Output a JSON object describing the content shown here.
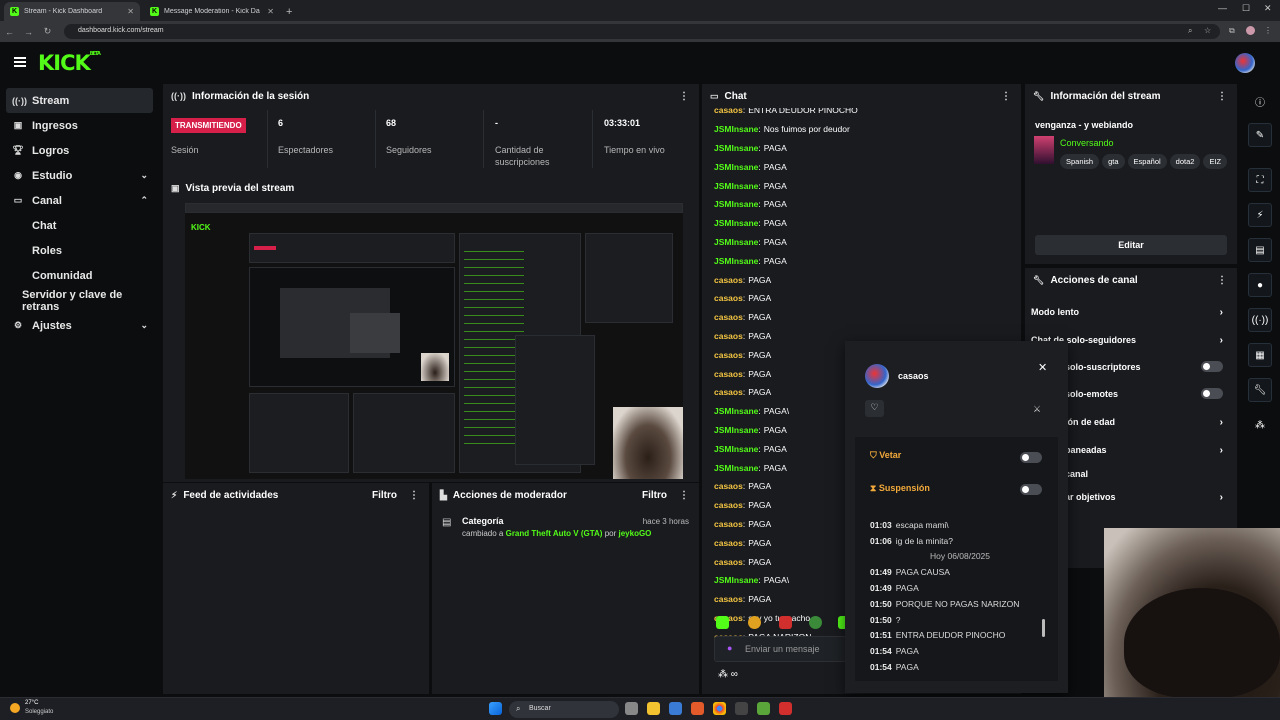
{
  "browser": {
    "tabs": [
      {
        "title": "Stream - Kick Dashboard",
        "active": true
      },
      {
        "title": "Message Moderation - Kick Da",
        "active": false
      }
    ],
    "new_tab": "+",
    "url": "dashboard.kick.com/stream"
  },
  "header": {
    "logo": "KICK",
    "logo_badge": "BETA"
  },
  "sidebar": {
    "items": [
      {
        "label": "Stream",
        "icon": "broadcast-icon"
      },
      {
        "label": "Ingresos",
        "icon": "wallet-icon"
      },
      {
        "label": "Logros",
        "icon": "trophy-icon"
      },
      {
        "label": "Estudio",
        "icon": "studio-icon"
      },
      {
        "label": "Canal",
        "icon": "channel-icon"
      },
      {
        "label": "Chat"
      },
      {
        "label": "Roles"
      },
      {
        "label": "Comunidad"
      },
      {
        "label": "Servidor y clave de retrans"
      },
      {
        "label": "Ajustes",
        "icon": "gear-icon"
      }
    ]
  },
  "session": {
    "title": "Información de la sesión",
    "status_badge": "TRANSMITIENDO",
    "status_label": "Sesión",
    "viewers_value": "6",
    "viewers_label": "Espectadores",
    "followers_value": "68",
    "followers_label": "Seguidores",
    "subs_value": "-",
    "subs_label": "Cantidad de suscripciones",
    "uptime_value": "03:33:01",
    "uptime_label": "Tiempo en vivo"
  },
  "preview": {
    "title": "Vista previa del stream"
  },
  "activity": {
    "title": "Feed de actividades",
    "filter": "Filtro"
  },
  "modactions": {
    "title": "Acciones de moderador",
    "filter": "Filtro",
    "entry_title": "Categoría",
    "entry_time": "hace 3 horas",
    "entry_prefix": "cambiado a",
    "entry_category": "Grand Theft Auto V (GTA)",
    "entry_by": "por",
    "entry_user": "jeykoGO"
  },
  "chat": {
    "title": "Chat",
    "messages": [
      {
        "user": "casaos",
        "text": "ENTRA DEUDOR PINOCHO",
        "color": "#f4c542"
      },
      {
        "user": "JSMInsane",
        "text": "Nos fuimos por deudor",
        "color": "#53fc18"
      },
      {
        "user": "JSMInsane",
        "text": "PAGA",
        "color": "#53fc18"
      },
      {
        "user": "JSMInsane",
        "text": "PAGA",
        "color": "#53fc18"
      },
      {
        "user": "JSMInsane",
        "text": "PAGA",
        "color": "#53fc18"
      },
      {
        "user": "JSMInsane",
        "text": "PAGA",
        "color": "#53fc18"
      },
      {
        "user": "JSMInsane",
        "text": "PAGA",
        "color": "#53fc18"
      },
      {
        "user": "JSMInsane",
        "text": "PAGA",
        "color": "#53fc18"
      },
      {
        "user": "JSMInsane",
        "text": "PAGA",
        "color": "#53fc18"
      },
      {
        "user": "casaos",
        "text": "PAGA",
        "color": "#f4c542"
      },
      {
        "user": "casaos",
        "text": "PAGA",
        "color": "#f4c542"
      },
      {
        "user": "casaos",
        "text": "PAGA",
        "color": "#f4c542"
      },
      {
        "user": "casaos",
        "text": "PAGA",
        "color": "#f4c542"
      },
      {
        "user": "casaos",
        "text": "PAGA",
        "color": "#f4c542"
      },
      {
        "user": "casaos",
        "text": "PAGA",
        "color": "#f4c542"
      },
      {
        "user": "casaos",
        "text": "PAGA",
        "color": "#f4c542"
      },
      {
        "user": "JSMInsane",
        "text": "PAGA\\",
        "color": "#53fc18"
      },
      {
        "user": "JSMInsane",
        "text": "PAGA",
        "color": "#53fc18"
      },
      {
        "user": "JSMInsane",
        "text": "PAGA",
        "color": "#53fc18"
      },
      {
        "user": "JSMInsane",
        "text": "PAGA",
        "color": "#53fc18"
      },
      {
        "user": "casaos",
        "text": "PAGA",
        "color": "#f4c542"
      },
      {
        "user": "casaos",
        "text": "PAGA",
        "color": "#f4c542"
      },
      {
        "user": "casaos",
        "text": "PAGA",
        "color": "#f4c542"
      },
      {
        "user": "casaos",
        "text": "PAGA",
        "color": "#f4c542"
      },
      {
        "user": "casaos",
        "text": "PAGA",
        "color": "#f4c542"
      },
      {
        "user": "JSMInsane",
        "text": "PAGA\\",
        "color": "#53fc18"
      },
      {
        "user": "casaos",
        "text": "PAGA",
        "color": "#f4c542"
      },
      {
        "user": "casaos",
        "text": "soy yo tu macho",
        "color": "#f4c542"
      },
      {
        "user": "casaos",
        "text": "PAGA NARIZON",
        "color": "#f4c542"
      }
    ],
    "input_placeholder": "Enviar un mensaje",
    "infinity": "∞"
  },
  "streaminfo": {
    "title": "Información del stream",
    "stream_title": "venganza - y webiando",
    "category": "Conversando",
    "tags": [
      "Spanish",
      "gta",
      "Español",
      "dota2",
      "EIZ"
    ],
    "edit_button": "Editar"
  },
  "channelactions": {
    "title": "Acciones de canal",
    "rows": [
      {
        "label": "Modo lento"
      },
      {
        "label": "Chat de solo-seguidores"
      },
      {
        "label": "solo-suscriptores"
      },
      {
        "label": "solo-emotes"
      },
      {
        "label": "ión de edad"
      },
      {
        "label": "baneadas"
      },
      {
        "label": "canal"
      },
      {
        "label": "ar objetivos"
      }
    ]
  },
  "popup": {
    "username": "casaos",
    "ban_label": "Vetar",
    "timeout_label": "Suspensión",
    "history": [
      {
        "time": "01:03",
        "text": "escapa mami\\"
      },
      {
        "time": "01:06",
        "text": "ig de la minita?"
      },
      {
        "time": "",
        "text": "Hoy 06/08/2025"
      },
      {
        "time": "01:49",
        "text": "PAGA CAUSA"
      },
      {
        "time": "01:49",
        "text": "PAGA"
      },
      {
        "time": "01:50",
        "text": "PORQUE NO PAGAS NARIZON"
      },
      {
        "time": "01:50",
        "text": "?"
      },
      {
        "time": "01:51",
        "text": "ENTRA DEUDOR PINOCHO"
      },
      {
        "time": "01:54",
        "text": "PAGA"
      },
      {
        "time": "01:54",
        "text": "PAGA"
      }
    ]
  },
  "taskbar": {
    "weather_temp": "27°C",
    "weather_desc": "Soleggiato",
    "search": "Buscar"
  }
}
